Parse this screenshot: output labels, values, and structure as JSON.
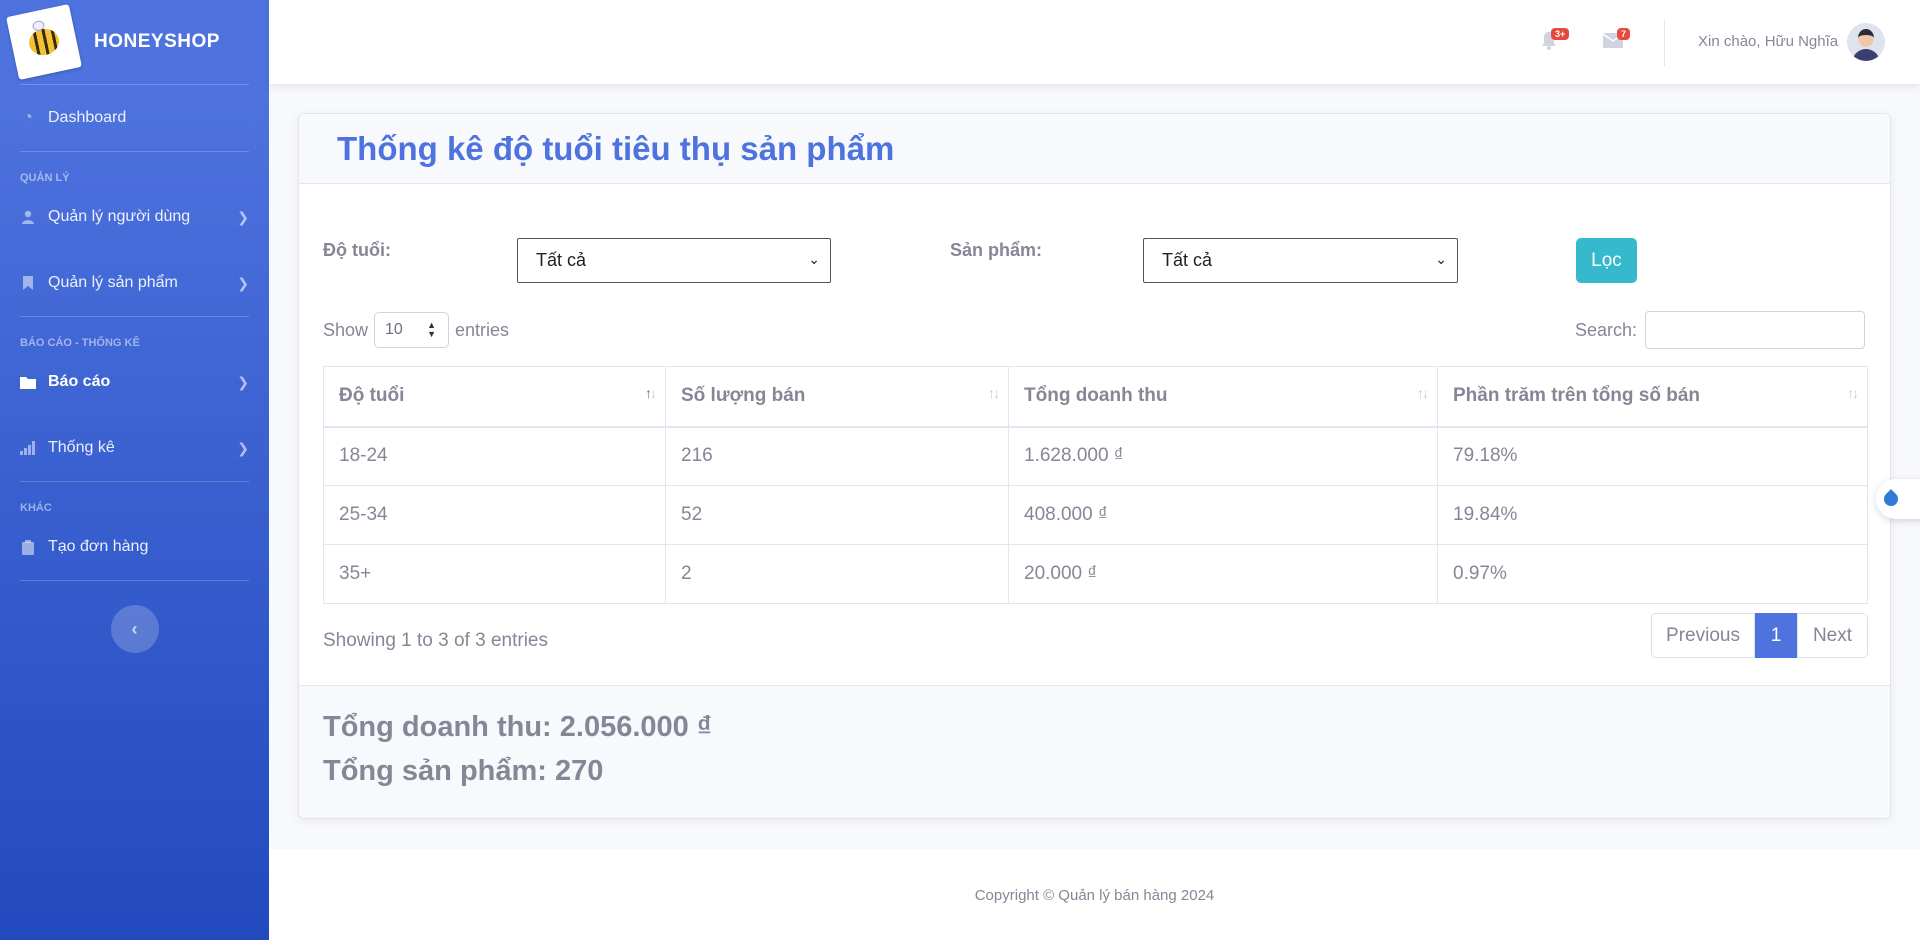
{
  "brand": {
    "name": "HONEYSHOP"
  },
  "sidebar": {
    "dashboard": "Dashboard",
    "heading_manage": "QUẢN LÝ",
    "users": "Quản lý người dùng",
    "products": "Quản lý sản phẩm",
    "heading_reports": "BÁO CÁO - THỐNG KÊ",
    "reports": "Báo cáo",
    "stats": "Thống kê",
    "heading_other": "KHÁC",
    "create_order": "Tạo đơn hàng"
  },
  "topbar": {
    "alerts_badge": "3+",
    "messages_badge": "7",
    "greeting": "Xin chào, Hữu Nghĩa"
  },
  "page": {
    "title": "Thống kê độ tuổi tiêu thụ sản phẩm"
  },
  "filters": {
    "age_label": "Độ tuổi:",
    "age_value": "Tất cả",
    "product_label": "Sản phẩm:",
    "product_value": "Tất cả",
    "filter_button": "Lọc"
  },
  "table_controls": {
    "show": "Show",
    "entries_value": "10",
    "entries": "entries",
    "search_label": "Search:"
  },
  "table": {
    "headers": [
      "Độ tuổi",
      "Số lượng bán",
      "Tổng doanh thu",
      "Phần trăm trên tổng số bán"
    ],
    "rows": [
      [
        "18-24",
        "216",
        "1.628.000 ₫",
        "79.18%"
      ],
      [
        "25-34",
        "52",
        "408.000 ₫",
        "19.84%"
      ],
      [
        "35+",
        "2",
        "20.000 ₫",
        "0.97%"
      ]
    ]
  },
  "pagination": {
    "info": "Showing 1 to 3 of 3 entries",
    "previous": "Previous",
    "current": "1",
    "next": "Next"
  },
  "summary": {
    "revenue": "Tổng doanh thu: 2.056.000 ₫",
    "products": "Tổng sản phẩm: 270"
  },
  "footer": {
    "copyright": "Copyright © Quản lý bán hàng 2024"
  }
}
